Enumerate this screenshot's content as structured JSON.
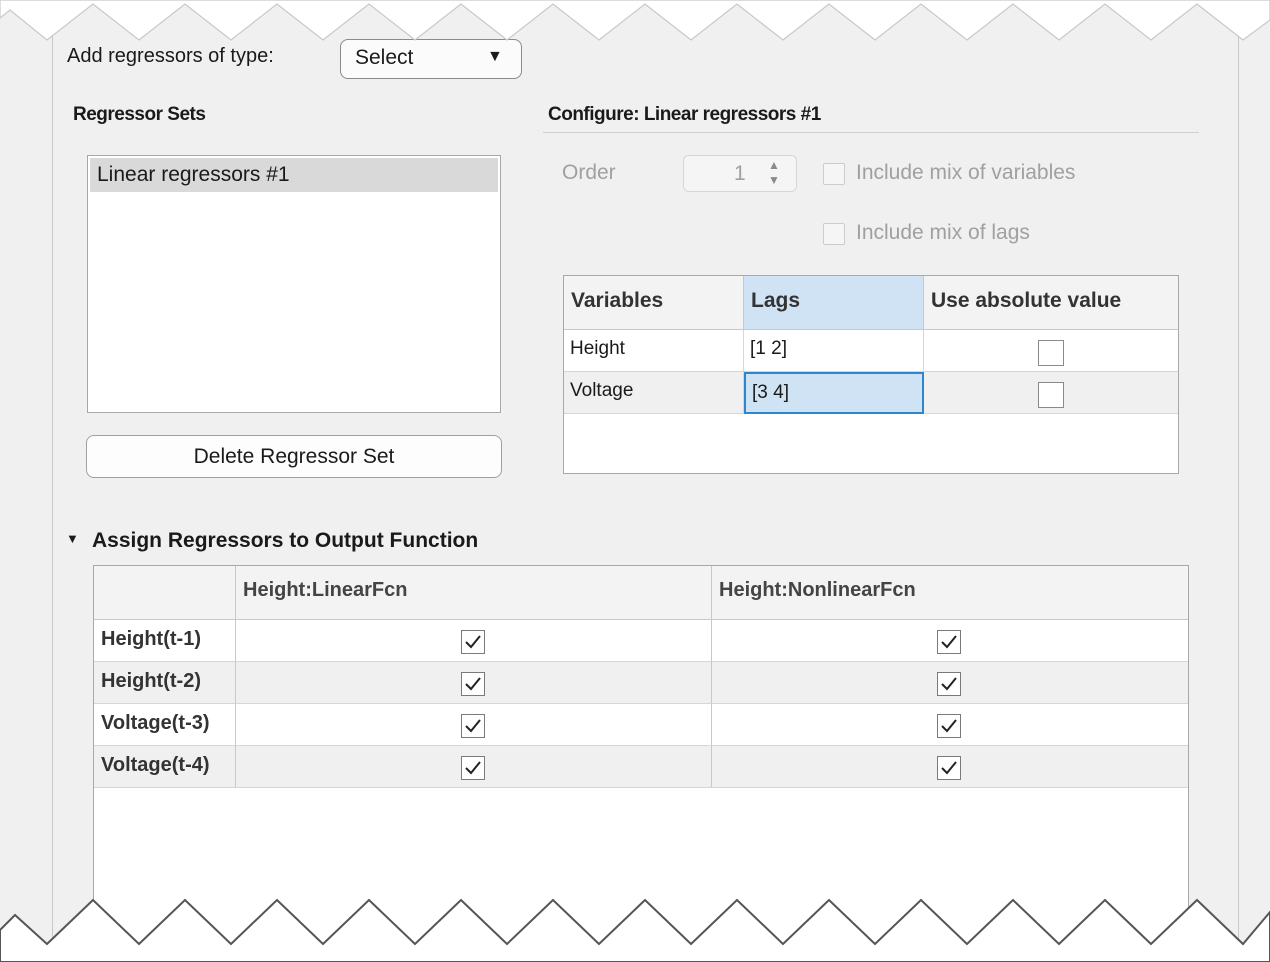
{
  "toolbar": {
    "add_label": "Add regressors of type:",
    "select_value": "Select",
    "select_arrow": "▼"
  },
  "regressor_sets": {
    "heading": "Regressor Sets",
    "items": [
      "Linear regressors #1"
    ],
    "delete_button": "Delete Regressor Set"
  },
  "configure": {
    "heading": "Configure: Linear regressors #1",
    "order_label": "Order",
    "order_value": "1",
    "include_mix_vars": "Include mix of variables",
    "include_mix_lags": "Include mix of lags",
    "include_mix_vars_checked": false,
    "include_mix_lags_checked": false,
    "table": {
      "headers": [
        "Variables",
        "Lags",
        "Use absolute value"
      ],
      "rows": [
        {
          "variable": "Height",
          "lags": "[1 2]",
          "absolute": false
        },
        {
          "variable": "Voltage",
          "lags": "[3 4]",
          "absolute": false
        }
      ]
    }
  },
  "assign": {
    "caret": "▼",
    "heading": "Assign Regressors to Output Function",
    "headers": [
      "",
      "Height:LinearFcn",
      "Height:NonlinearFcn"
    ],
    "rows": [
      {
        "name": "Height(t-1)",
        "linear": true,
        "nonlinear": true
      },
      {
        "name": "Height(t-2)",
        "linear": true,
        "nonlinear": true
      },
      {
        "name": "Voltage(t-3)",
        "linear": true,
        "nonlinear": true
      },
      {
        "name": "Voltage(t-4)",
        "linear": true,
        "nonlinear": true
      }
    ]
  },
  "colors": {
    "panel_bg": "#f0f0f0",
    "selected_header": "#cfe3f5",
    "active_cell_border": "#2a87d0"
  }
}
